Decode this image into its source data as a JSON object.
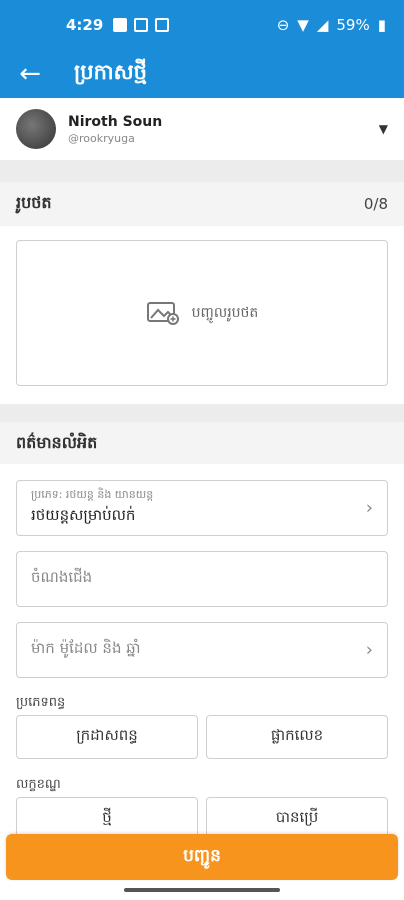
{
  "status": {
    "time": "4:29",
    "battery": "59%"
  },
  "header": {
    "title": "ប្រកាសថ្មី"
  },
  "user": {
    "name": "Niroth Soun",
    "handle": "@rookryuga"
  },
  "photos": {
    "section_title": "រូបថត",
    "count": "0/8",
    "add_label": "បញ្ចូលរូបថត"
  },
  "info": {
    "section_title": "ពត៌មានលំអិត"
  },
  "fields": {
    "category_label": "ប្រភេទ: រថយន្ត និង យានយន្ត",
    "category_value": "រថយន្តសម្រាប់លក់",
    "title_placeholder": "ចំណងជើង",
    "brand_placeholder": "ម៉ាក ម៉ូដែល និង ឆ្នាំ"
  },
  "tax_type": {
    "label": "ប្រភេទពន្ធ",
    "options": [
      "ក្រដាសពន្ធ",
      "ផ្លាកលេខ"
    ]
  },
  "condition": {
    "label": "លក្ខខណ្ឌ",
    "options": [
      "ថ្មី",
      "បានប្រើ"
    ]
  },
  "submit": {
    "label": "បញ្ជូន"
  },
  "colors": {
    "appbar": "#1a8cd8",
    "submit": "#f7941d"
  }
}
